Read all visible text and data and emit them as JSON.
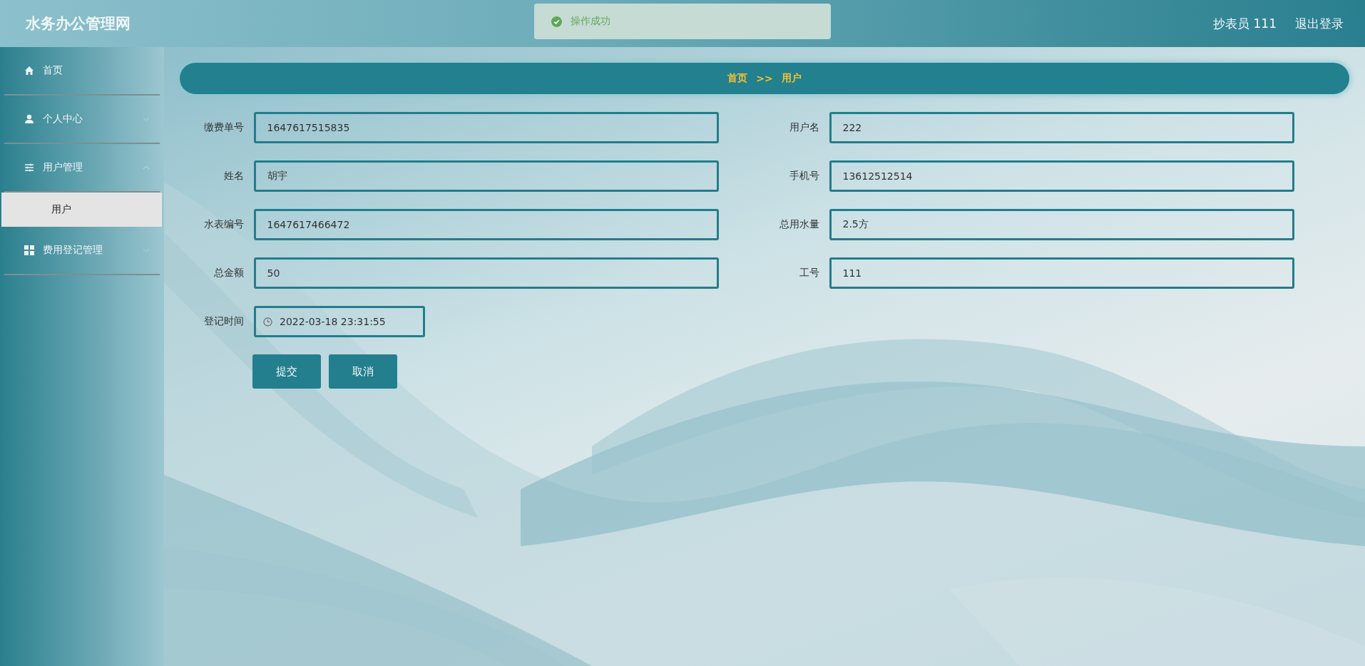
{
  "header": {
    "title": "水务办公管理网",
    "user_label": "抄表员 111",
    "logout": "退出登录"
  },
  "toast": {
    "kind": "success",
    "message": "操作成功"
  },
  "sidebar": {
    "items": [
      {
        "label": "首页",
        "selected": false
      },
      {
        "label": "个人中心",
        "selected": false,
        "expanded": false
      },
      {
        "label": "用户管理",
        "selected": false,
        "expanded": true,
        "children": [
          {
            "label": "用户",
            "selected": true
          }
        ]
      },
      {
        "label": "费用登记管理",
        "selected": false,
        "expanded": false
      }
    ]
  },
  "breadcrumb": {
    "items": [
      "首页",
      "用户"
    ],
    "separator": ">>"
  },
  "form": {
    "fields": [
      {
        "label": "缴费单号",
        "value": "1647617515835",
        "kind": "text"
      },
      {
        "label": "用户名",
        "value": "222",
        "kind": "text"
      },
      {
        "label": "姓名",
        "value": "胡宇",
        "kind": "text"
      },
      {
        "label": "手机号",
        "value": "13612512514",
        "kind": "text"
      },
      {
        "label": "水表编号",
        "value": "1647617466472",
        "kind": "text"
      },
      {
        "label": "总用水量",
        "value": "2.5方",
        "kind": "text"
      },
      {
        "label": "总金额",
        "value": "50",
        "kind": "text"
      },
      {
        "label": "工号",
        "value": "111",
        "kind": "text"
      },
      {
        "label": "登记时间",
        "value": "2022-03-18 23:31:55",
        "kind": "datetime"
      }
    ],
    "buttons": [
      "提交",
      "取消"
    ]
  }
}
